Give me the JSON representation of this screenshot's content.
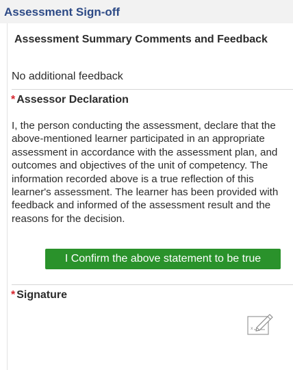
{
  "header": {
    "title": "Assessment Sign-off"
  },
  "summary": {
    "heading": "Assessment Summary Comments and Feedback",
    "feedback_value": "No additional feedback"
  },
  "declaration": {
    "required_marker": "*",
    "heading": "Assessor Declaration",
    "text": "I, the person conducting the assessment, declare that the above-mentioned learner participated in an appropriate assessment in accordance with the assessment plan, and outcomes and objectives of the unit of competency. The information recorded above is a true reflection of this learner's assessment. The learner has been provided with feedback and informed of the assessment result and the reasons for the decision.",
    "confirm_button_label": "I Confirm the above statement to be true"
  },
  "signature": {
    "required_marker": "*",
    "heading": "Signature",
    "icon": "sign-pen-icon"
  },
  "colors": {
    "header_title": "#2d4a86",
    "required": "#d6232c",
    "confirm_button": "#2a922b"
  }
}
